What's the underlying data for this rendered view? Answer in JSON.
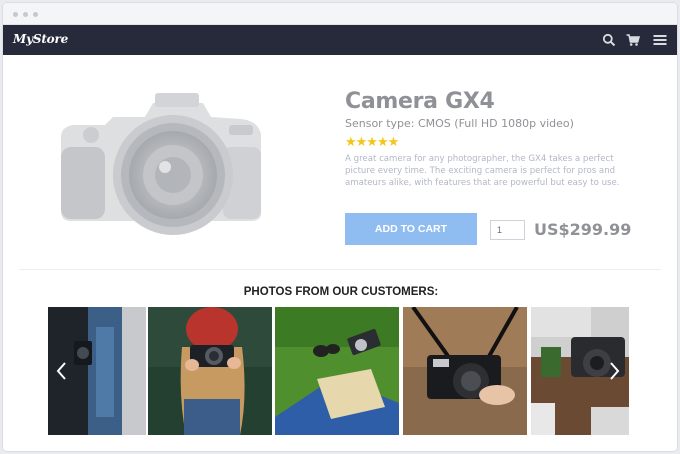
{
  "app": {
    "brand": "MyStore",
    "nav_icons": [
      "search-icon",
      "cart-icon",
      "menu-icon"
    ]
  },
  "product": {
    "name": "Camera GX4",
    "subtitle": "Sensor type: CMOS (Full HD 1080p video)",
    "rating": 5,
    "rating_max": 5,
    "stars_text": "★★★★★",
    "description": "A great camera for any photographer, the GX4 takes a perfect picture every time. The exciting camera is perfect for pros and amateurs alike, with features that are powerful but easy to use.",
    "add_to_cart_label": "ADD TO CART",
    "quantity": "1",
    "price": "US$299.99"
  },
  "gallery": {
    "title": "PHOTOS FROM OUR CUSTOMERS:",
    "prev_icon": "chevron-left-icon",
    "next_icon": "chevron-right-icon",
    "photo_count": 5
  },
  "colors": {
    "navbar": "#272a3a",
    "button": "#8fbdf2",
    "star": "#f5c518",
    "muted_text": "#8f9196"
  }
}
